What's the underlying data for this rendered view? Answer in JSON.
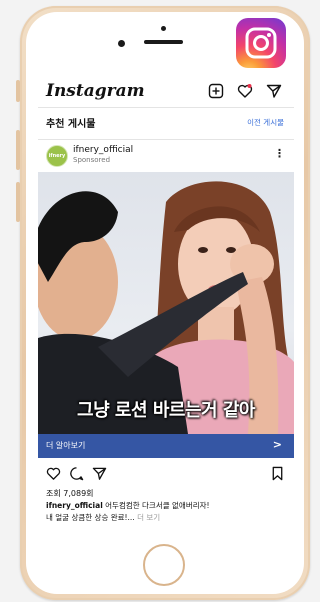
{
  "app": {
    "wordmark": "Instagram"
  },
  "recommended": {
    "title": "추천 게시물",
    "previous_label": "이전 게시물"
  },
  "post": {
    "account": "ifnery_official",
    "sponsored": "Sponsored",
    "avatar_text": "ifnery",
    "image_caption": "그냥 로션 바르는거 같아",
    "cta_label": "더 알아보기",
    "cta_arrow": ">",
    "likes": "조회 7,089회",
    "caption_account": "ifnery_official",
    "caption_text": " 어두컴컴한 다크서클 없애버리자!",
    "caption_line2": "내 얼굴 상큼한 상승 완료!...",
    "caption_more": " 더 보기"
  },
  "colors": {
    "cta_bar": "#3556a4",
    "link_blue": "#3a6fd8",
    "frame_gold": "#e7c8a6"
  },
  "icons": [
    "instagram-logo-icon",
    "add-post-icon",
    "heart-notification-icon",
    "direct-message-icon",
    "like-icon",
    "comment-icon",
    "share-icon",
    "bookmark-icon",
    "more-options-icon"
  ]
}
